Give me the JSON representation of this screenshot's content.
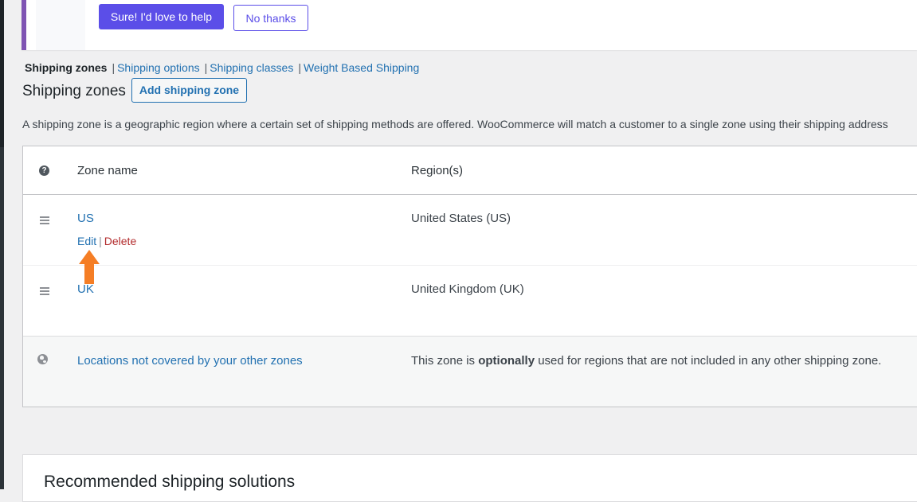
{
  "notice": {
    "primary_button": "Sure! I'd love to help",
    "secondary_button": "No thanks"
  },
  "subnav": {
    "current": "Shipping zones",
    "links": [
      "Shipping options",
      "Shipping classes",
      "Weight Based Shipping"
    ],
    "separator": "|"
  },
  "page": {
    "title": "Shipping zones",
    "add_button": "Add shipping zone",
    "description": "A shipping zone is a geographic region where a certain set of shipping methods are offered. WooCommerce will match a customer to a single zone using their shipping address"
  },
  "table": {
    "help_icon": "?",
    "columns": [
      "Zone name",
      "Region(s)"
    ],
    "rows": [
      {
        "zone": "US",
        "region": "United States (US)",
        "actions": {
          "edit": "Edit",
          "separator": "|",
          "delete": "Delete"
        }
      },
      {
        "zone": "UK",
        "region": "United Kingdom (UK)"
      }
    ],
    "other_row": {
      "zone": "Locations not covered by your other zones",
      "region_before": "This zone is ",
      "region_bold": "optionally",
      "region_after": " used for regions that are not included in any other shipping zone."
    }
  },
  "recommended": {
    "title": "Recommended shipping solutions"
  },
  "colors": {
    "accent": "#5b4ee8",
    "link": "#2271b1",
    "delete": "#b32d2e",
    "arrow": "#f57e25"
  },
  "icons": [
    "help-icon",
    "drag-handle-icon",
    "globe-icon",
    "arrow-up-icon"
  ]
}
